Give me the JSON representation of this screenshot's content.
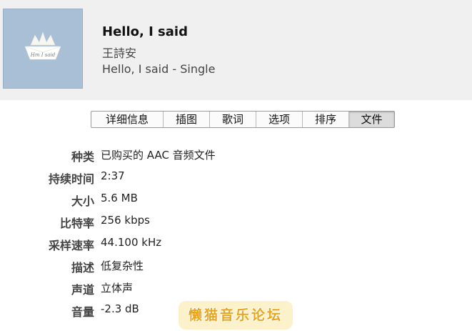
{
  "song": {
    "title": "Hello, I said",
    "artist": "王詩安",
    "album": "Hello, I said - Single",
    "artwork_text": "Hm I said",
    "artwork_color": "#a8bfd6"
  },
  "tabs": [
    {
      "label": "详细信息",
      "active": false
    },
    {
      "label": "插图",
      "active": false
    },
    {
      "label": "歌词",
      "active": false
    },
    {
      "label": "选项",
      "active": false
    },
    {
      "label": "排序",
      "active": false
    },
    {
      "label": "文件",
      "active": true
    }
  ],
  "file_info": [
    {
      "label": "种类",
      "value": "已购买的 AAC 音频文件"
    },
    {
      "label": "持续时间",
      "value": "2:37"
    },
    {
      "label": "大小",
      "value": "5.6 MB"
    },
    {
      "label": "比特率",
      "value": "256 kbps"
    },
    {
      "label": "采样速率",
      "value": "44.100 kHz"
    },
    {
      "label": "描述",
      "value": "低复杂性"
    },
    {
      "label": "声道",
      "value": "立体声"
    },
    {
      "label": "音量",
      "value": "-2.3 dB"
    }
  ],
  "watermark": {
    "text": "懒猫音乐论坛",
    "color": "#e8a520"
  }
}
